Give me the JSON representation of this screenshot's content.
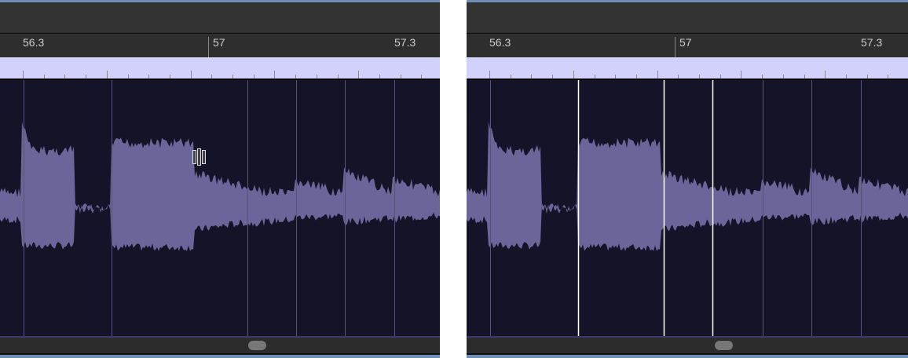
{
  "panels": [
    {
      "id": "before",
      "ruler_labels": [
        "56.3",
        "57",
        "57.3"
      ],
      "transients": [
        30,
        142,
        315,
        377,
        439,
        502
      ],
      "selected_transients": []
    },
    {
      "id": "after",
      "ruler_labels": [
        "56.3",
        "57",
        "57.3"
      ],
      "transients": [
        30,
        377,
        439,
        502
      ],
      "selected_transients": [
        142,
        251,
        313
      ]
    }
  ],
  "colors": {
    "waveform": "#6a6699",
    "background": "#141428",
    "transient": "#55557a",
    "selected": "#ffffff"
  }
}
